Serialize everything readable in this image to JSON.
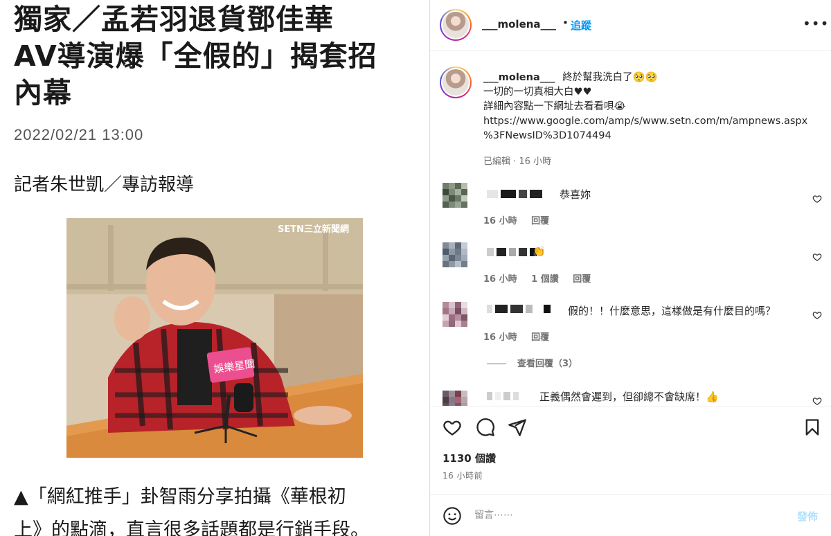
{
  "article": {
    "headline_line1": "獨家／孟若羽退貨鄧佳華",
    "headline_line2": "AV導演爆「全假的」揭套招",
    "headline_line3": "內幕",
    "date": "2022/02/21 13:00",
    "byline": "記者朱世凱／專訪報導",
    "photo_watermark": "SETN三立新聞網",
    "mic_flag_text": "娛樂星聞",
    "caption_line1": "▲「網紅推手」卦智雨分享拍攝《華根初",
    "caption_line2": "上》的點滴，直言很多話題都是行銷手段。"
  },
  "post": {
    "username": "___molena___",
    "dot": "•",
    "follow_label": "追蹤",
    "more_label": "•••",
    "caption": {
      "username": "___molena___",
      "line1": "終於幫我洗白了🥺🥺",
      "line2": "一切的一切真相大白♥♥",
      "line3": "詳細內容點一下網址去看看唄😭",
      "line4": "https://www.google.com/amp/s/www.setn.com/m/ampnews.aspx",
      "line5": "%3FNewsID%3D1074494",
      "meta": "已編輯 · 16 小時"
    },
    "comments": [
      {
        "text": "恭喜妳",
        "time": "16 小時",
        "likes": "",
        "reply": "回覆"
      },
      {
        "text": "👏",
        "time": "16 小時",
        "likes": "1 個讚",
        "reply": "回覆"
      },
      {
        "text": "假的！！什麼意思，這樣做是有什麼目的嗎？",
        "time": "16 小時",
        "likes": "",
        "reply": "回覆"
      },
      {
        "text": "正義偶然會遲到，但卻總不會缺席！👍",
        "time": "",
        "likes": "",
        "reply": ""
      }
    ],
    "view_replies": "查看回覆（3）",
    "views": "1130 個讚",
    "time_ago": "16 小時前",
    "comment_placeholder": "留言⋯⋯",
    "post_button": "發佈",
    "colors": {
      "link": "#0095f6",
      "post_disabled": "#b2dffc",
      "meta": "#737373"
    }
  }
}
